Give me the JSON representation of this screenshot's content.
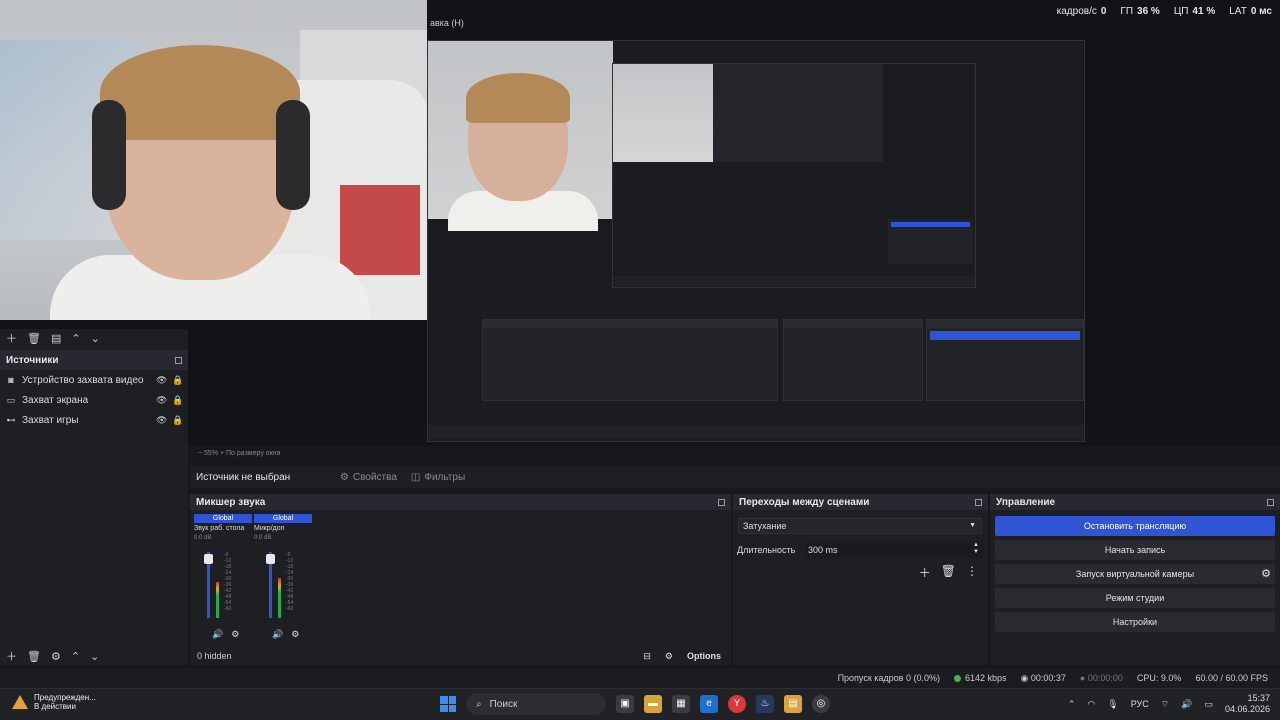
{
  "stats": {
    "fps_label": "кадров/с",
    "fps_value": "0",
    "gpu_label": "ГП",
    "gpu_value": "36 %",
    "cpu_label": "ЦП",
    "cpu_value": "41 %",
    "lat_label": "LAT",
    "lat_value": "0 мс"
  },
  "preview": {
    "partial_title": "авка (Н)"
  },
  "zoom": {
    "text": "−  55%  +  По размеру окна"
  },
  "source_bar": {
    "label": "Источник не выбран",
    "properties": "Свойства",
    "filters": "Фильтры"
  },
  "sources": {
    "title": "Источники",
    "items": [
      {
        "name": "Устройство захвата видео",
        "icon": "camera-icon"
      },
      {
        "name": "Захват экрана",
        "icon": "monitor-icon"
      },
      {
        "name": "Захват игры",
        "icon": "gamepad-icon"
      }
    ]
  },
  "mixer": {
    "title": "Микшер звука",
    "channels": [
      {
        "tag": "Global",
        "name": "Звук раб. стола",
        "db": "0.0 dB",
        "level": 0.55
      },
      {
        "tag": "Global",
        "name": "Микр/доп",
        "db": "0.0 dB",
        "level": 0.6
      }
    ],
    "hidden": "0 hidden",
    "options": "Options"
  },
  "transitions": {
    "title": "Переходы между сценами",
    "selected": "Затухание",
    "duration_label": "Длительность",
    "duration_value": "300 ms"
  },
  "controls": {
    "title": "Управление",
    "stop_stream": "Остановить трансляцию",
    "start_record": "Начать запись",
    "virtual_cam": "Запуск виртуальной камеры",
    "studio_mode": "Режим студии",
    "settings": "Настройки"
  },
  "status": {
    "dropped": "Пропуск кадров 0 (0.0%)",
    "bitrate": "6142 kbps",
    "stream_time": "00:00:37",
    "rec_time": "00:00:00",
    "cpu": "CPU: 9.0%",
    "fps": "60.00 / 60.00 FPS"
  },
  "taskbar": {
    "warn_title": "Предупрежден...",
    "warn_sub": "В действии",
    "search": "Поиск",
    "lang": "РУС",
    "time": "15:37",
    "date": "04.06.2026"
  },
  "colors": {
    "accent": "#2f55d4",
    "panel": "#1e1f23",
    "background": "#17181c"
  }
}
